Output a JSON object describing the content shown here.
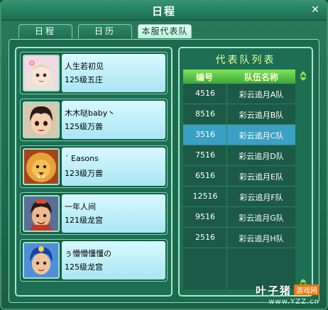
{
  "window": {
    "title": "日程"
  },
  "tabs": [
    {
      "label": "日程"
    },
    {
      "label": "日历"
    },
    {
      "label": "本服代表队",
      "active": true
    }
  ],
  "members": [
    {
      "name": "人生若初见",
      "level": "125级五庄",
      "avatar": "girl-avatar"
    },
    {
      "name": "木木哒baby丶",
      "level": "125级万兽",
      "avatar": "boy-avatar"
    },
    {
      "name": "ˊ Easons",
      "level": "123级万兽",
      "avatar": "lion-avatar"
    },
    {
      "name": "一年人间",
      "level": "121级龙宫",
      "avatar": "warrior-avatar"
    },
    {
      "name": "ぅ懵懵懂懂の",
      "level": "125级龙宫",
      "avatar": "blue-hair-avatar"
    }
  ],
  "team_list": {
    "title": "代表队列表",
    "headers": {
      "number": "编号",
      "team_name": "队伍名称"
    },
    "rows": [
      {
        "number": "4516",
        "team": "彩云追月A队"
      },
      {
        "number": "8516",
        "team": "彩云追月B队"
      },
      {
        "number": "3516",
        "team": "彩云追月C队",
        "selected": true
      },
      {
        "number": "7516",
        "team": "彩云追月D队"
      },
      {
        "number": "6516",
        "team": "彩云追月E队"
      },
      {
        "number": "12516",
        "team": "彩云追月F队"
      },
      {
        "number": "9516",
        "team": "彩云追月G队"
      },
      {
        "number": "2516",
        "team": "彩云追月H队"
      }
    ]
  },
  "watermark": {
    "main": "叶子猪",
    "badge": "游戏网",
    "url": "www.YZZ.cn"
  },
  "colors": {
    "window_bg": "#1a5e46",
    "header_green": "#3aa838",
    "selected_row": "#3aa0c4",
    "title_yellow": "#e4ff9c"
  }
}
